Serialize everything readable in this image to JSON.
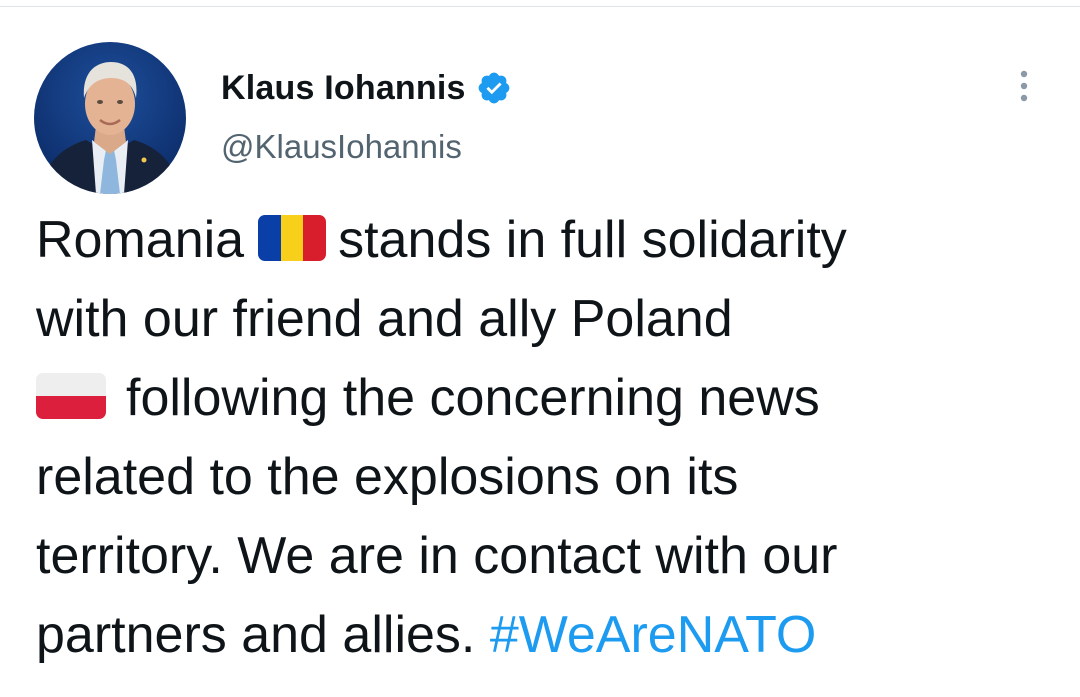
{
  "tweet": {
    "author": {
      "display_name": "Klaus Iohannis",
      "handle": "@KlausIohannis",
      "verified": true,
      "avatar_icon": "profile-photo"
    },
    "menu_icon": "more-vertical-icon",
    "text": {
      "line1_before_flag": "Romania",
      "line1_flag": "romania-flag-emoji",
      "line1_after_flag": "stands in full solidarity",
      "line2": "with our friend and ally Poland",
      "line3_flag": "poland-flag-emoji",
      "line3_after_flag": "following the concerning news",
      "line4": "related to the explosions on its",
      "line5": "territory. We are in contact with our",
      "line6_before_hashtag": "partners and allies.",
      "hashtag": "#WeAreNATO"
    }
  },
  "colors": {
    "text": "#0f1419",
    "secondary_text": "#536471",
    "link": "#1d9bf0",
    "verified_badge": "#1d9bf0",
    "background": "#ffffff"
  }
}
